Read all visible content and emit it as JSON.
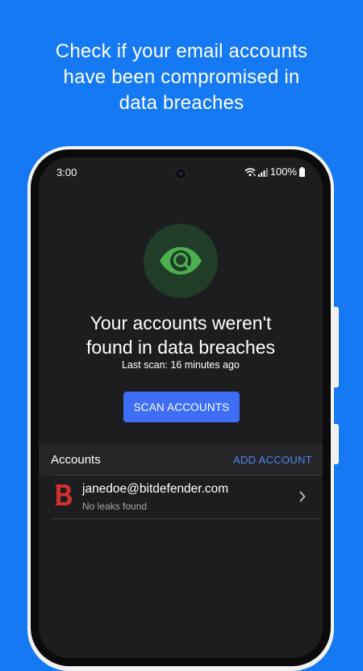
{
  "promo": {
    "headline_line1": "Check if your email accounts",
    "headline_line2": "have been compromised in",
    "headline_line3": "data breaches"
  },
  "status_bar": {
    "time": "3:00",
    "battery": "100%",
    "icons": [
      "wifi-icon",
      "signal-icon",
      "battery-icon"
    ]
  },
  "main": {
    "badge_icon": "eye-search-icon",
    "title_line1": "Your accounts weren't",
    "title_line2": "found in data breaches",
    "last_scan": "Last scan: 16 minutes ago",
    "scan_button": "SCAN ACCOUNTS"
  },
  "accounts": {
    "header": "Accounts",
    "add_button": "ADD ACCOUNT",
    "items": [
      {
        "logo": "bitdefender-logo",
        "email": "janedoe@bitdefender.com",
        "status": "No leaks found"
      }
    ]
  },
  "colors": {
    "background": "#1479f3",
    "screen": "#1d1d1f",
    "accent": "#3d6ef5",
    "link": "#4d86f7",
    "badge": "#1f3d27",
    "eye": "#4caf50",
    "brand_red": "#d32f2f"
  }
}
